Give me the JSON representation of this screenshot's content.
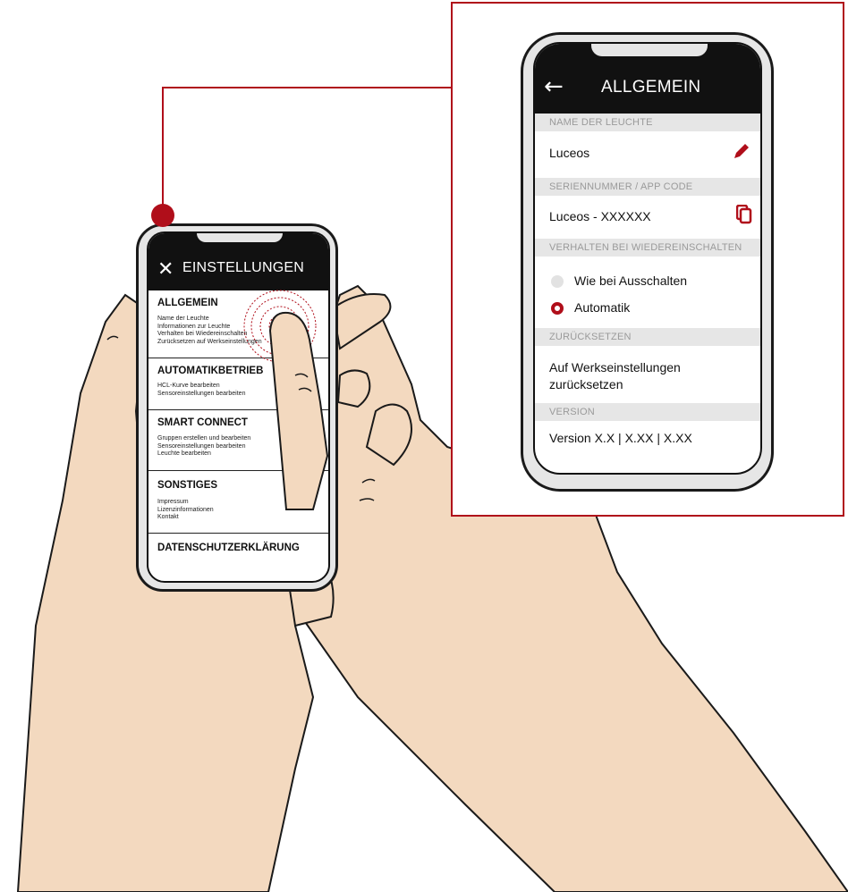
{
  "small_phone": {
    "title": "EINSTELLUNGEN",
    "close_icon": "close-icon",
    "sections": [
      {
        "title": "ALLGEMEIN",
        "lines": [
          "Name der Leuchte",
          "Informationen zur Leuchte",
          "Verhalten bei Wiedereinschalten",
          "Zurücksetzen auf Werkseinstellungen"
        ]
      },
      {
        "title": "AUTOMATIKBETRIEB",
        "lines": [
          "HCL-Kurve bearbeiten",
          "Sensoreinstellungen bearbeiten"
        ]
      },
      {
        "title": "SMART CONNECT",
        "lines": [
          "Gruppen erstellen und bearbeiten",
          "Sensoreinstellungen bearbeiten",
          "Leuchte bearbeiten"
        ]
      },
      {
        "title": "SONSTIGES",
        "lines": [
          "Impressum",
          "Lizenzinformationen",
          "Kontakt"
        ]
      },
      {
        "title": "DATENSCHUTZERKLÄRUNG",
        "lines": []
      }
    ],
    "chevron_icon": "chevron-right-icon"
  },
  "large_phone": {
    "title": "ALLGEMEIN",
    "back_icon": "arrow-left-icon",
    "name_header": "NAME DER LEUCHTE",
    "name_value": "Luceos",
    "serial_header": "SERIENNUMMER / APP CODE",
    "serial_value": "Luceos - XXXXXX",
    "behavior_header": "VERHALTEN BEI WIEDEREINSCHALTEN",
    "option_1": "Wie bei Ausschalten",
    "option_2": "Automatik",
    "selected_option": "Automatik",
    "reset_header": "ZURÜCKSETZEN",
    "reset_value": "Auf Werkseinstellungen zurücksetzen",
    "version_header": "VERSION",
    "version_value": "Version X.X | X.XX | X.XX"
  },
  "colors": {
    "accent": "#b00e1a",
    "skin": "#f3d9bf",
    "outline": "#1a1a1a",
    "category_bg": "#e6e6e6"
  }
}
